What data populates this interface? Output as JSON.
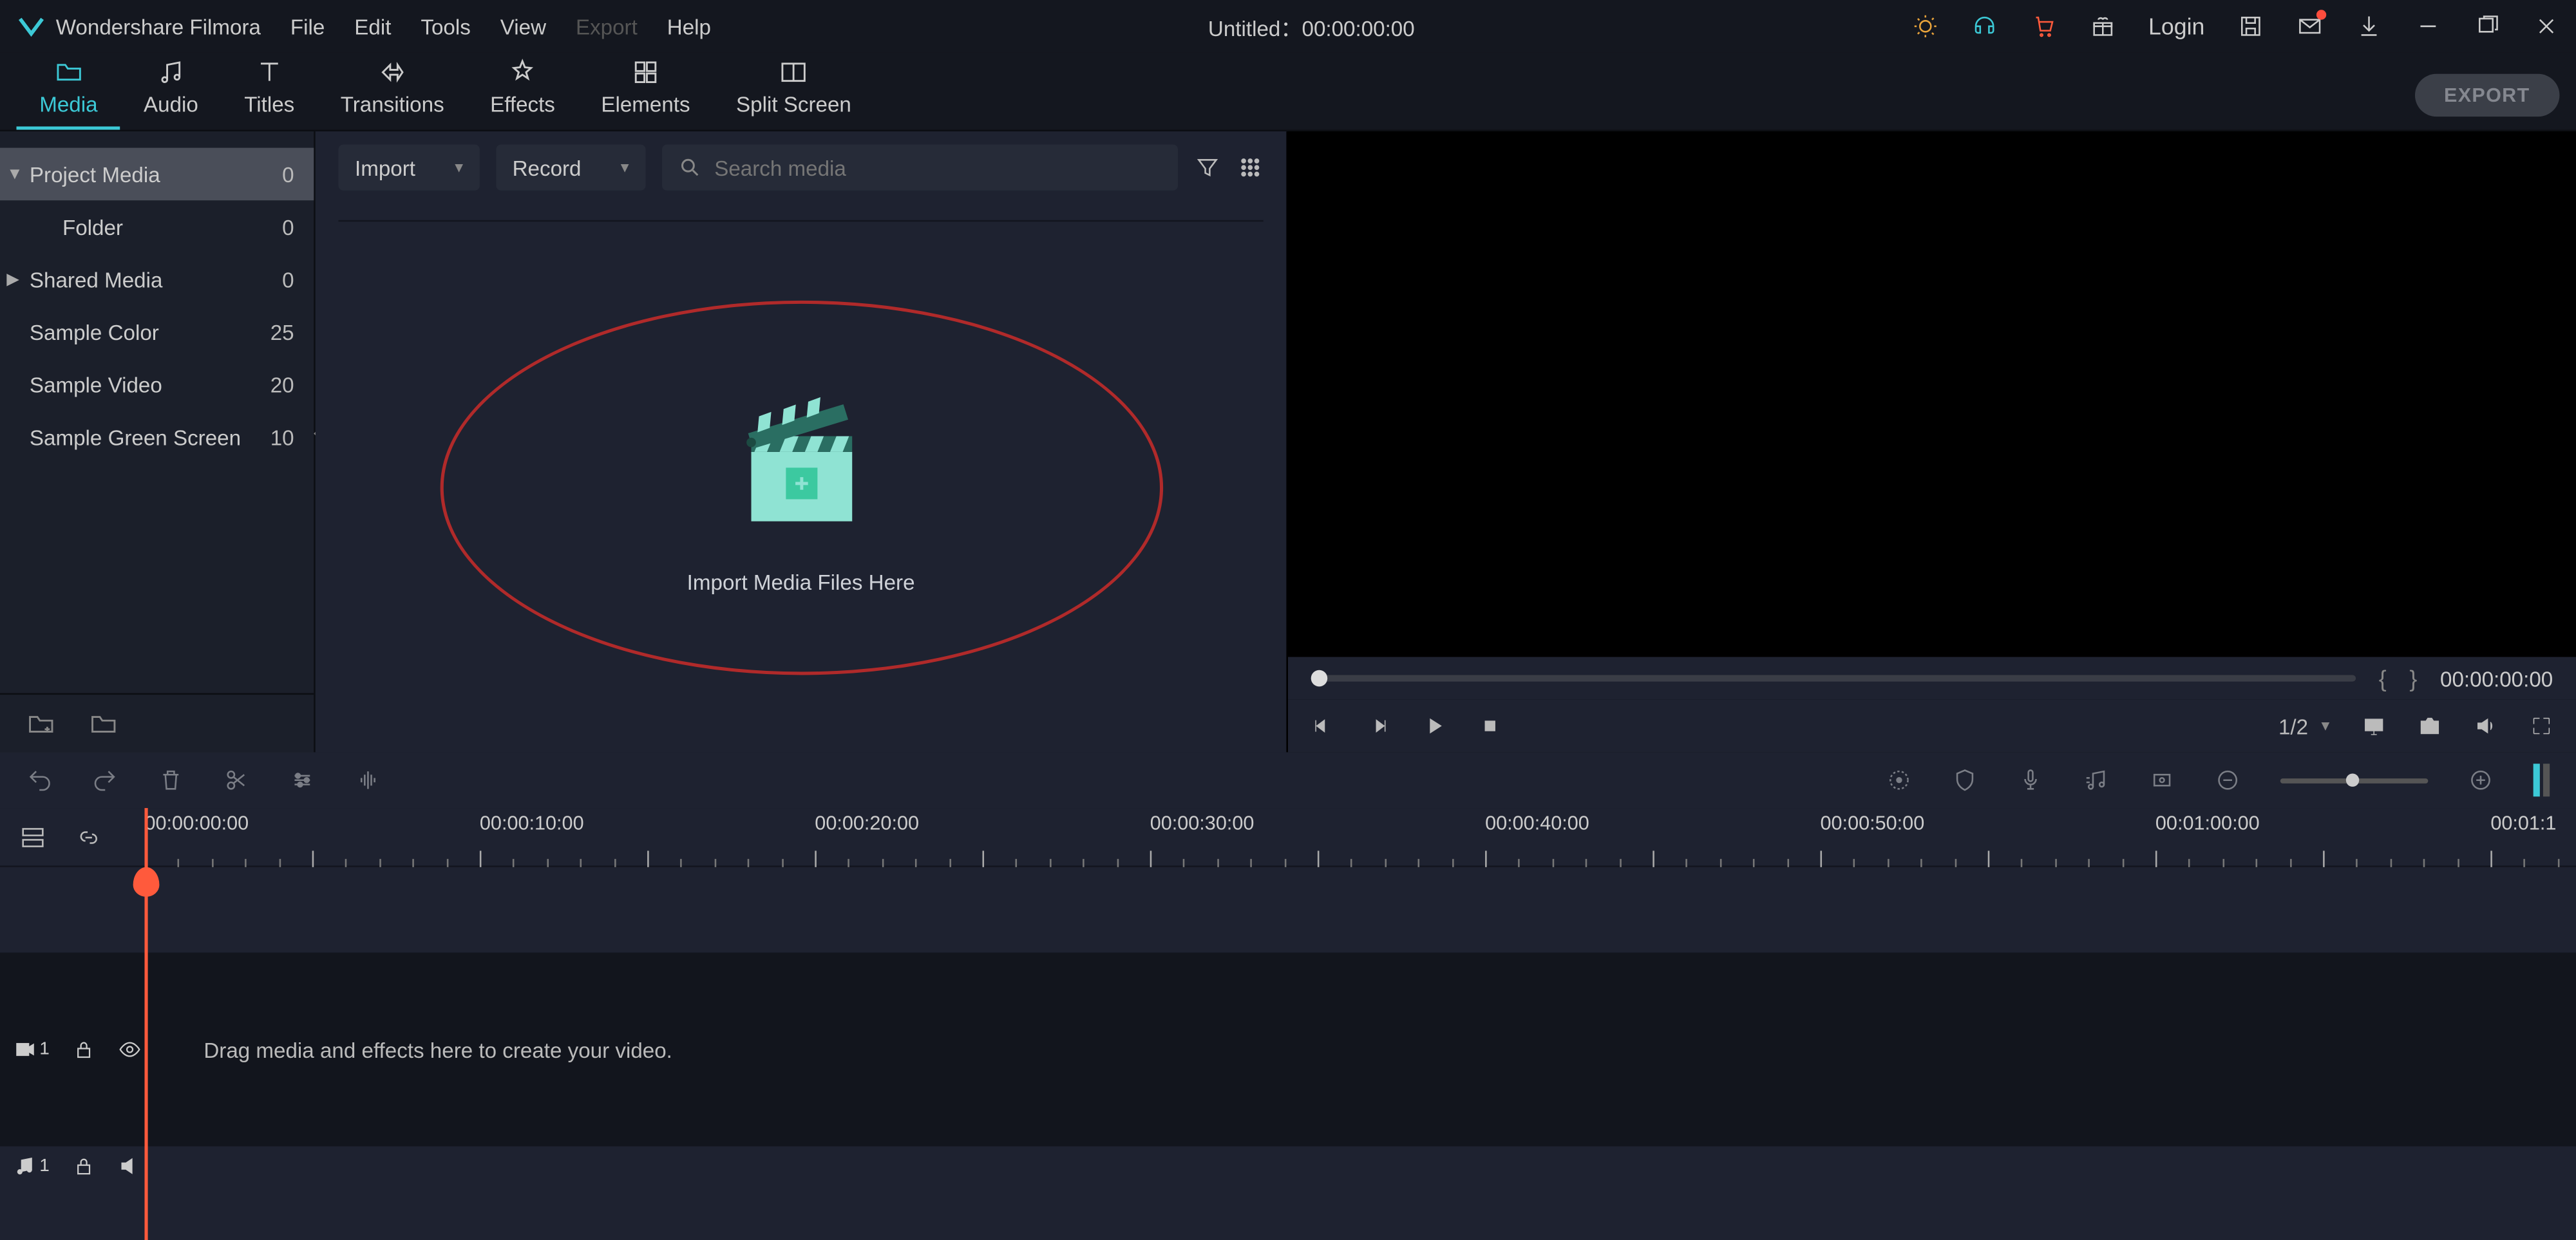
{
  "app": {
    "name": "Wondershare Filmora",
    "title_center": "Untitled：00:00:00:00"
  },
  "menu": [
    "File",
    "Edit",
    "Tools",
    "View",
    "Export",
    "Help"
  ],
  "menu_disabled_index": 4,
  "titlebar": {
    "login": "Login"
  },
  "tabs": [
    "Media",
    "Audio",
    "Titles",
    "Transitions",
    "Effects",
    "Elements",
    "Split Screen"
  ],
  "tabs_active_index": 0,
  "export_button": "EXPORT",
  "sidebar": {
    "items": [
      {
        "label": "Project Media",
        "count": "0",
        "selected": true,
        "arrow": "down",
        "indent": false
      },
      {
        "label": "Folder",
        "count": "0",
        "indent": true
      },
      {
        "label": "Shared Media",
        "count": "0",
        "arrow": "right",
        "indent": false
      },
      {
        "label": "Sample Color",
        "count": "25",
        "indent": false
      },
      {
        "label": "Sample Video",
        "count": "20",
        "indent": false
      },
      {
        "label": "Sample Green Screen",
        "count": "10",
        "indent": false
      }
    ]
  },
  "media": {
    "import": "Import",
    "record": "Record",
    "search_placeholder": "Search media",
    "drop_label": "Import Media Files Here"
  },
  "preview": {
    "marker_in": "{",
    "marker_out": "}",
    "timecode": "00:00:00:00",
    "ratio": "1/2"
  },
  "timeline": {
    "ruler_labels": [
      "00:00:00:00",
      "00:00:10:00",
      "00:00:20:00",
      "00:00:30:00",
      "00:00:40:00",
      "00:00:50:00",
      "00:01:00:00",
      "00:01:1"
    ],
    "video_track": "1",
    "audio_track": "1",
    "placeholder": "Drag media and effects here to create your video."
  }
}
